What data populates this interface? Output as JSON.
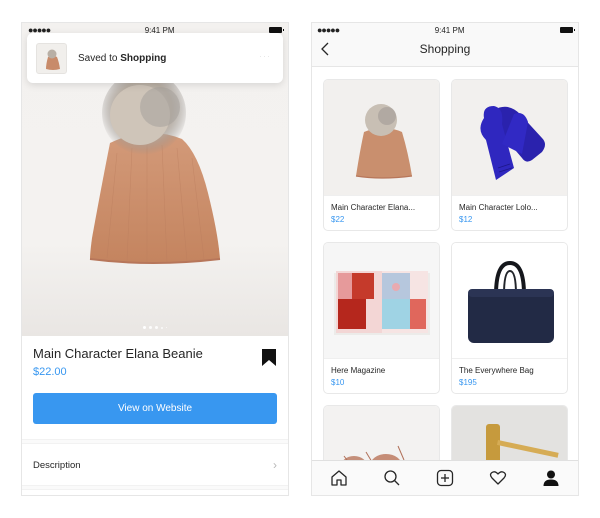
{
  "left_screen": {
    "status_bar": {
      "time": "9:41 PM",
      "signal": "●●●●●"
    },
    "toast": {
      "prefix": "Saved to ",
      "collection": "Shopping",
      "more": "···"
    },
    "carousel": {
      "current_index": 1,
      "total_dots": 5
    },
    "product": {
      "title": "Main Character Elana Beanie",
      "price": "$22.00",
      "saved": true
    },
    "buttons": {
      "view_on_website": "View on Website"
    },
    "rows": [
      {
        "label": "Description"
      }
    ]
  },
  "right_screen": {
    "status_bar": {
      "time": "9:41 PM",
      "signal": "●●●●●"
    },
    "header": {
      "title": "Shopping"
    },
    "items": [
      {
        "name": "Main Character Elana...",
        "price": "$22",
        "image": "beanie"
      },
      {
        "name": "Main Character Lolo...",
        "price": "$12",
        "image": "mittens"
      },
      {
        "name": "Here Magazine",
        "price": "$10",
        "image": "magazine"
      },
      {
        "name": "The Everywhere Bag",
        "price": "$195",
        "image": "bag"
      },
      {
        "name": "",
        "price": "",
        "image": "fur-slippers"
      },
      {
        "name": "",
        "price": "",
        "image": "brass-gavel"
      }
    ],
    "tabbar": [
      {
        "icon": "home-icon",
        "label": "Home"
      },
      {
        "icon": "search-icon",
        "label": "Search"
      },
      {
        "icon": "add-post-icon",
        "label": "New Post"
      },
      {
        "icon": "heart-icon",
        "label": "Activity"
      },
      {
        "icon": "profile-icon",
        "label": "Profile"
      }
    ]
  },
  "colors": {
    "accent": "#3897f0",
    "text": "#262626",
    "mittens": "#2b23b5",
    "bag": "#232a44",
    "beanie": "#c88b6a"
  }
}
